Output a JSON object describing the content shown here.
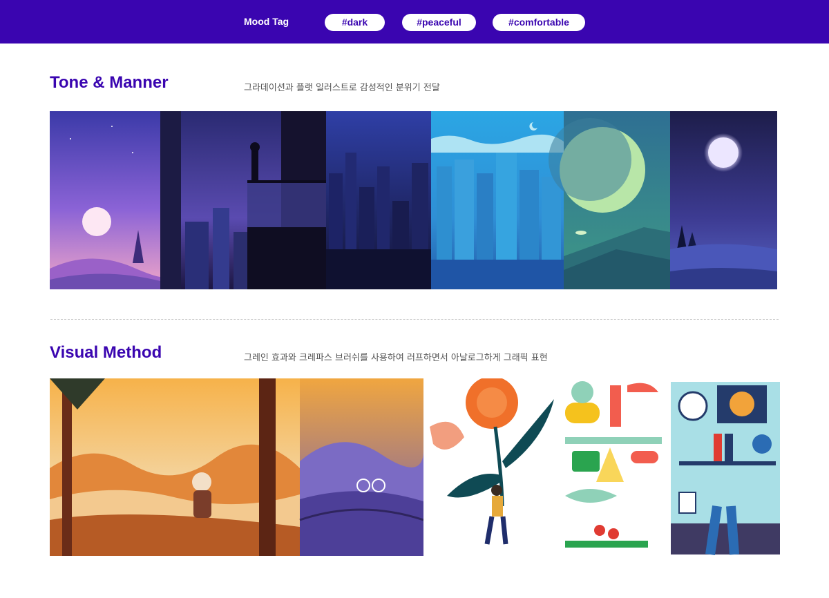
{
  "header": {
    "mood_label": "Mood Tag",
    "tags": [
      "#dark",
      "#peaceful",
      "#comfortable"
    ],
    "background": "#3a05b0"
  },
  "tone": {
    "title": "Tone & Manner",
    "description": "그라데이션과 플랫 일러스트로 감성적인 분위기 전달",
    "images": [
      {
        "icon": "purple-sunset-hills"
      },
      {
        "icon": "pixel-night-balcony"
      },
      {
        "icon": "night-city-skyline"
      },
      {
        "icon": "blue-pixel-city"
      },
      {
        "icon": "green-moon-ufo"
      },
      {
        "icon": "full-moon-lake"
      }
    ]
  },
  "visual": {
    "title": "Visual Method",
    "description": "그레인 효과와 크레파스 브러쉬를 사용하여 러프하면서 아날로그하게 그래픽 표현",
    "images": [
      {
        "icon": "autumn-hiker-and-cyclist"
      },
      {
        "icon": "woman-with-flower"
      },
      {
        "icon": "still-life-and-desk"
      }
    ]
  },
  "colors": {
    "accent": "#3a05b0",
    "divider": "#c8c8c8"
  }
}
